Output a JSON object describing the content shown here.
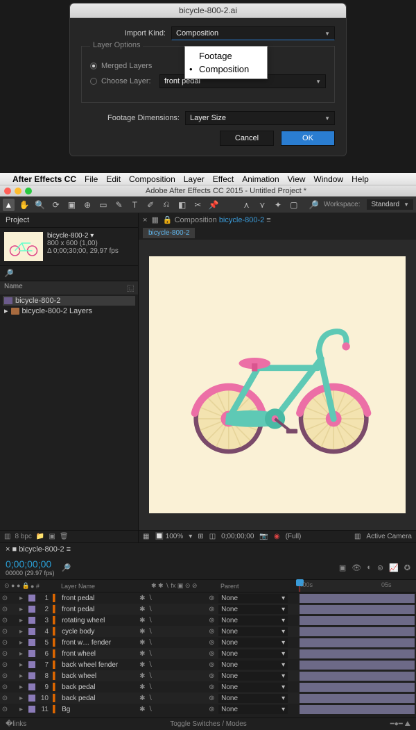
{
  "dialog": {
    "title": "bicycle-800-2.ai",
    "import_kind_label": "Import Kind:",
    "import_kind_value": "Composition",
    "popup_options": [
      "Footage",
      "Composition"
    ],
    "popup_selected": "Composition",
    "layer_options_label": "Layer Options",
    "merged_label": "Merged Layers",
    "choose_label": "Choose Layer:",
    "choose_value": "front pedal",
    "footage_dim_label": "Footage Dimensions:",
    "footage_dim_value": "Layer Size",
    "cancel": "Cancel",
    "ok": "OK"
  },
  "menubar": {
    "app": "After Effects CC",
    "items": [
      "File",
      "Edit",
      "Composition",
      "Layer",
      "Effect",
      "Animation",
      "View",
      "Window",
      "Help"
    ]
  },
  "window_title": "Adobe After Effects CC 2015 - Untitled Project *",
  "workspace": {
    "label": "Workspace:",
    "value": "Standard"
  },
  "project": {
    "tab": "Project",
    "item_name": "bicycle-800-2 ▾",
    "dims": "800 x 600 (1,00)",
    "dur": "Δ 0;00;30;00, 29,97 fps",
    "name_header": "Name",
    "tree_comp": "bicycle-800-2",
    "tree_folder": "bicycle-800-2 Layers",
    "bpc": "8 bpc"
  },
  "comp": {
    "prefix": "Composition",
    "name": "bicycle-800-2",
    "chip": "bicycle-800-2",
    "zoom": "100%",
    "time": "0;00;00;00",
    "res": "(Full)",
    "camera": "Active Camera"
  },
  "timeline": {
    "tab": "bicycle-800-2",
    "tc": "0;00;00;00",
    "tc_sub": "00000 (29.97 fps)",
    "col_layer": "Layer Name",
    "col_parent": "Parent",
    "ruler_ticks": [
      ":00s",
      "05s"
    ],
    "toggle_label": "Toggle Switches / Modes",
    "parent_none": "None",
    "layers": [
      {
        "n": 1,
        "name": "front pedal"
      },
      {
        "n": 2,
        "name": "front pedal"
      },
      {
        "n": 3,
        "name": "rotating wheel"
      },
      {
        "n": 4,
        "name": "cycle body"
      },
      {
        "n": 5,
        "name": "front w… fender"
      },
      {
        "n": 6,
        "name": "front wheel"
      },
      {
        "n": 7,
        "name": "back wheel fender"
      },
      {
        "n": 8,
        "name": "back wheel"
      },
      {
        "n": 9,
        "name": "back pedal"
      },
      {
        "n": 10,
        "name": "back pedal"
      },
      {
        "n": 11,
        "name": "Bg"
      }
    ]
  }
}
